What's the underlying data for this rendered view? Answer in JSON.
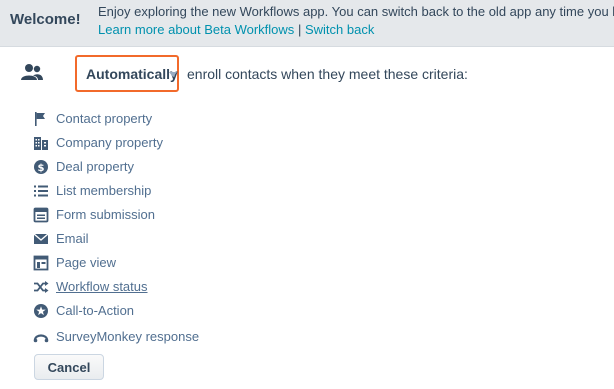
{
  "banner": {
    "title": "Welcome!",
    "message": "Enjoy exploring the new Workflows app. You can switch back to the old app any time you like.",
    "link_learn": "Learn more about Beta Workflows",
    "separator": "|",
    "link_switch": "Switch back"
  },
  "enrollment": {
    "mode": "Automatically",
    "text": "enroll contacts when they meet these criteria:",
    "icon": "contacts-icon"
  },
  "criteria": [
    {
      "label": "Contact property",
      "icon": "flag-icon"
    },
    {
      "label": "Company property",
      "icon": "building-icon"
    },
    {
      "label": "Deal property",
      "icon": "dollar-circle-icon"
    },
    {
      "label": "List membership",
      "icon": "list-icon"
    },
    {
      "label": "Form submission",
      "icon": "form-icon"
    },
    {
      "label": "Email",
      "icon": "envelope-icon"
    },
    {
      "label": "Page view",
      "icon": "page-icon"
    },
    {
      "label": "Workflow status",
      "icon": "shuffle-icon"
    },
    {
      "label": "Call-to-Action",
      "icon": "star-circle-icon"
    },
    {
      "label": "SurveyMonkey response",
      "icon": "surveymonkey-icon"
    }
  ],
  "colors": {
    "accent_border": "#f26a2b",
    "link": "#0091ae",
    "text": "#33475b",
    "muted_text": "#516f90",
    "icon": "#425b76"
  },
  "actions": {
    "cancel_label": "Cancel"
  }
}
